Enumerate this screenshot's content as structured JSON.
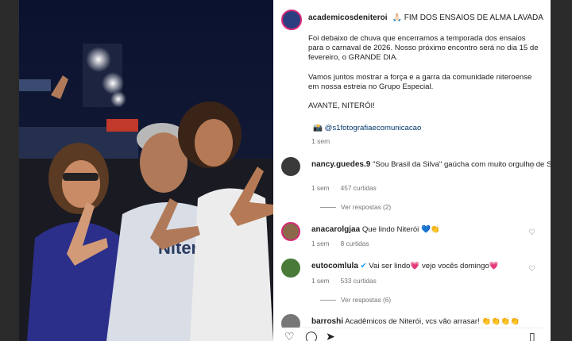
{
  "post": {
    "username": "academicosdeniteroi",
    "title": "🙏🏻 FIM DOS ENSAIOS DE ALMA LAVADA",
    "caption": [
      "Foi debaixo de chuva que encerramos a temporada dos ensaios para o carnaval de 2026. Nosso próximo encontro será no dia 15 de fevereiro, o GRANDE DIA.",
      "Vamos juntos mostrar a força e a garra da comunidade niteroense em nossa estreia no Grupo Especial.",
      "AVANTE, NITERÓI!"
    ],
    "credit": "📸 @s1fotografiaecomunicacao",
    "time": "1 sem"
  },
  "comments": [
    {
      "username": "nancy.guedes.9",
      "text": "\"Sou Brasil da Silva\" gaúcha com muito orgulho de Ser Feliz com \"LULÁÁÁ\" 👏🇧🇷💙🤍🚩💚🎊🎉",
      "time": "1 sem",
      "likes": "457 curtidas",
      "replies": "Ver respostas (2)",
      "avatar_color": "#3a3a3a"
    },
    {
      "username": "anacarolgjaa",
      "text": "Que lindo Niterói 💙👏",
      "time": "1 sem",
      "likes": "8 curtidas",
      "avatar_color": "#8a6a4a"
    },
    {
      "username": "eutocomlula",
      "text": "Vai ser lindo💗 vejo vocês domingo💗",
      "time": "1 sem",
      "likes": "533 curtidas",
      "replies": "Ver respostas (6)",
      "avatar_color": "#4a7a3a"
    },
    {
      "username": "barroshi",
      "text": "Acadêmicos de Niterói, vcs vão arrasar! 👏👏👏👏",
      "avatar_color": "#777"
    }
  ],
  "icons": [
    "heart-icon",
    "comment-icon",
    "share-icon",
    "bookmark-icon"
  ]
}
